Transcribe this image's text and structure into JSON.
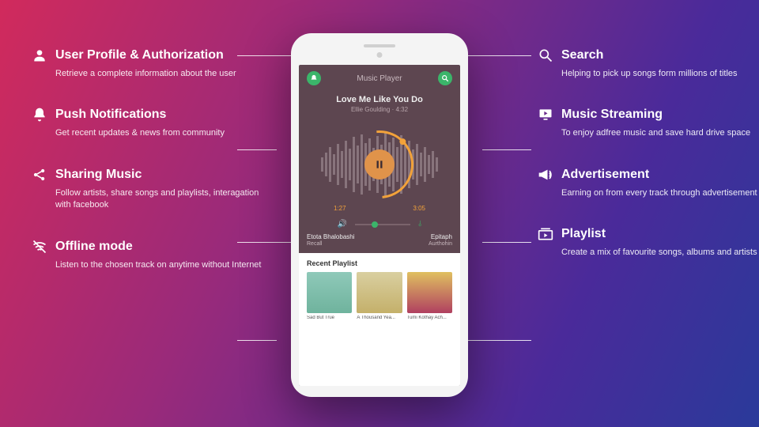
{
  "features_left": [
    {
      "title": "User Profile & Authorization",
      "desc": "Retrieve a complete information about the user"
    },
    {
      "title": "Push Notifications",
      "desc": "Get recent updates & news from community"
    },
    {
      "title": "Sharing Music",
      "desc": "Follow artists, share songs and playlists, interagation with facebook"
    },
    {
      "title": "Offline mode",
      "desc": "Listen to the chosen track on anytime without Internet"
    }
  ],
  "features_right": [
    {
      "title": "Search",
      "desc": "Helping to pick up songs form millions of titles"
    },
    {
      "title": "Music Streaming",
      "desc": "To enjoy adfree music and save hard drive space"
    },
    {
      "title": "Advertisement",
      "desc": "Earning on from every track through advertisement"
    },
    {
      "title": "Playlist",
      "desc": "Create a mix of favourite songs, albums and artists"
    }
  ],
  "app": {
    "title": "Music Player",
    "track_title": "Love Me Like You Do",
    "track_artist": "Ellie Goulding",
    "track_len": "4:32",
    "time_cur": "1:27",
    "time_end": "3:05",
    "queue": [
      {
        "title": "Etota Bhalobashi",
        "sub": "Recall"
      },
      {
        "title": "Epitaph",
        "sub": "Aurthohin"
      }
    ],
    "recent_header": "Recent Playlist",
    "recent": [
      {
        "caption": "Sad But True"
      },
      {
        "caption": "A Thousand Yea..."
      },
      {
        "caption": "Tumi Kothay Ach..."
      }
    ]
  }
}
